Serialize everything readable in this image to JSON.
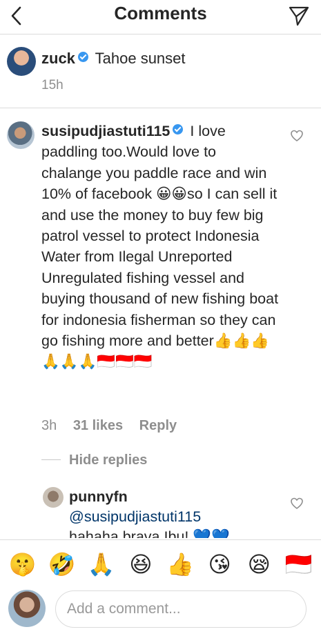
{
  "header": {
    "title": "Comments",
    "back_icon": "chevron-left-icon",
    "send_icon": "direct-send-icon"
  },
  "caption": {
    "username": "zuck",
    "text": "Tahoe sunset",
    "time": "15h"
  },
  "comment": {
    "username": "susipudjiastuti115",
    "text": "I love paddling too.Would love to chalange you paddle race and win 10% of facebook 😀😀so I can sell it and use the money to buy few big patrol vessel to protect Indonesia Water from Ilegal Unreported Unregulated fishing vessel and buying thousand of new fishing boat for indonesia fisherman so they can go fishing more and better👍👍👍🙏🙏🙏🇮🇩🇮🇩🇮🇩",
    "time": "3h",
    "likes": "31 likes",
    "reply_label": "Reply"
  },
  "replies": {
    "hide_label": "Hide replies"
  },
  "reply": {
    "username": "punnyfn",
    "mention": "@susipudjiastuti115",
    "text": "hahaha brava Ibu! 💙💙"
  },
  "emoji_bar": [
    "🤫",
    "🤣",
    "🙏",
    "😆",
    "👍",
    "😘",
    "😪",
    "🇮🇩"
  ],
  "input": {
    "placeholder": "Add a comment..."
  },
  "colors": {
    "accent": "#3897f0",
    "text": "#262626",
    "muted": "#8e8e8e",
    "border": "#dbdbdb"
  }
}
